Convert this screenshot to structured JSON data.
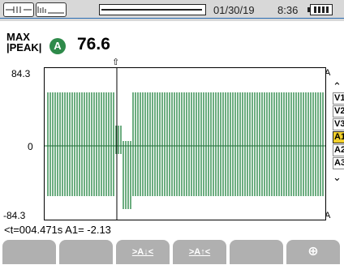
{
  "status_bar": {
    "date": "01/30/19",
    "time": "8:36",
    "battery_icon": "battery-full-icon",
    "tab_icons": [
      "waveform-tab-icon",
      "harmonics-tab-icon"
    ]
  },
  "measurement": {
    "mode_line1": "MAX",
    "mode_line2": "|PEAK|",
    "channel_badge": "A",
    "value": "76.6"
  },
  "plot": {
    "y_top": "84.3",
    "y_zero": "0",
    "y_bottom": "-84.3",
    "unit_top": "A",
    "unit_bottom": "A",
    "cursor_marker": "⇧",
    "trace_color": "#2e8a4a"
  },
  "cursor_readout": "<t=004.471s A1= -2.13",
  "channels": {
    "up_arrow": "⌃",
    "items": [
      "V1",
      "V2",
      "V3",
      "A1",
      "A2",
      "A3"
    ],
    "active": "A1",
    "down_arrow": "⌄"
  },
  "function_keys": [
    {
      "label": "",
      "icon": ""
    },
    {
      "label": "",
      "icon": ""
    },
    {
      "label": ">A↓<",
      "icon": ""
    },
    {
      "label": ">A↑<",
      "icon": ""
    },
    {
      "label": "",
      "icon": ""
    },
    {
      "label": "",
      "icon": "zoom-in-icon"
    }
  ],
  "colors": {
    "accent": "#2a6db3",
    "active_channel": "#f2d02a"
  }
}
